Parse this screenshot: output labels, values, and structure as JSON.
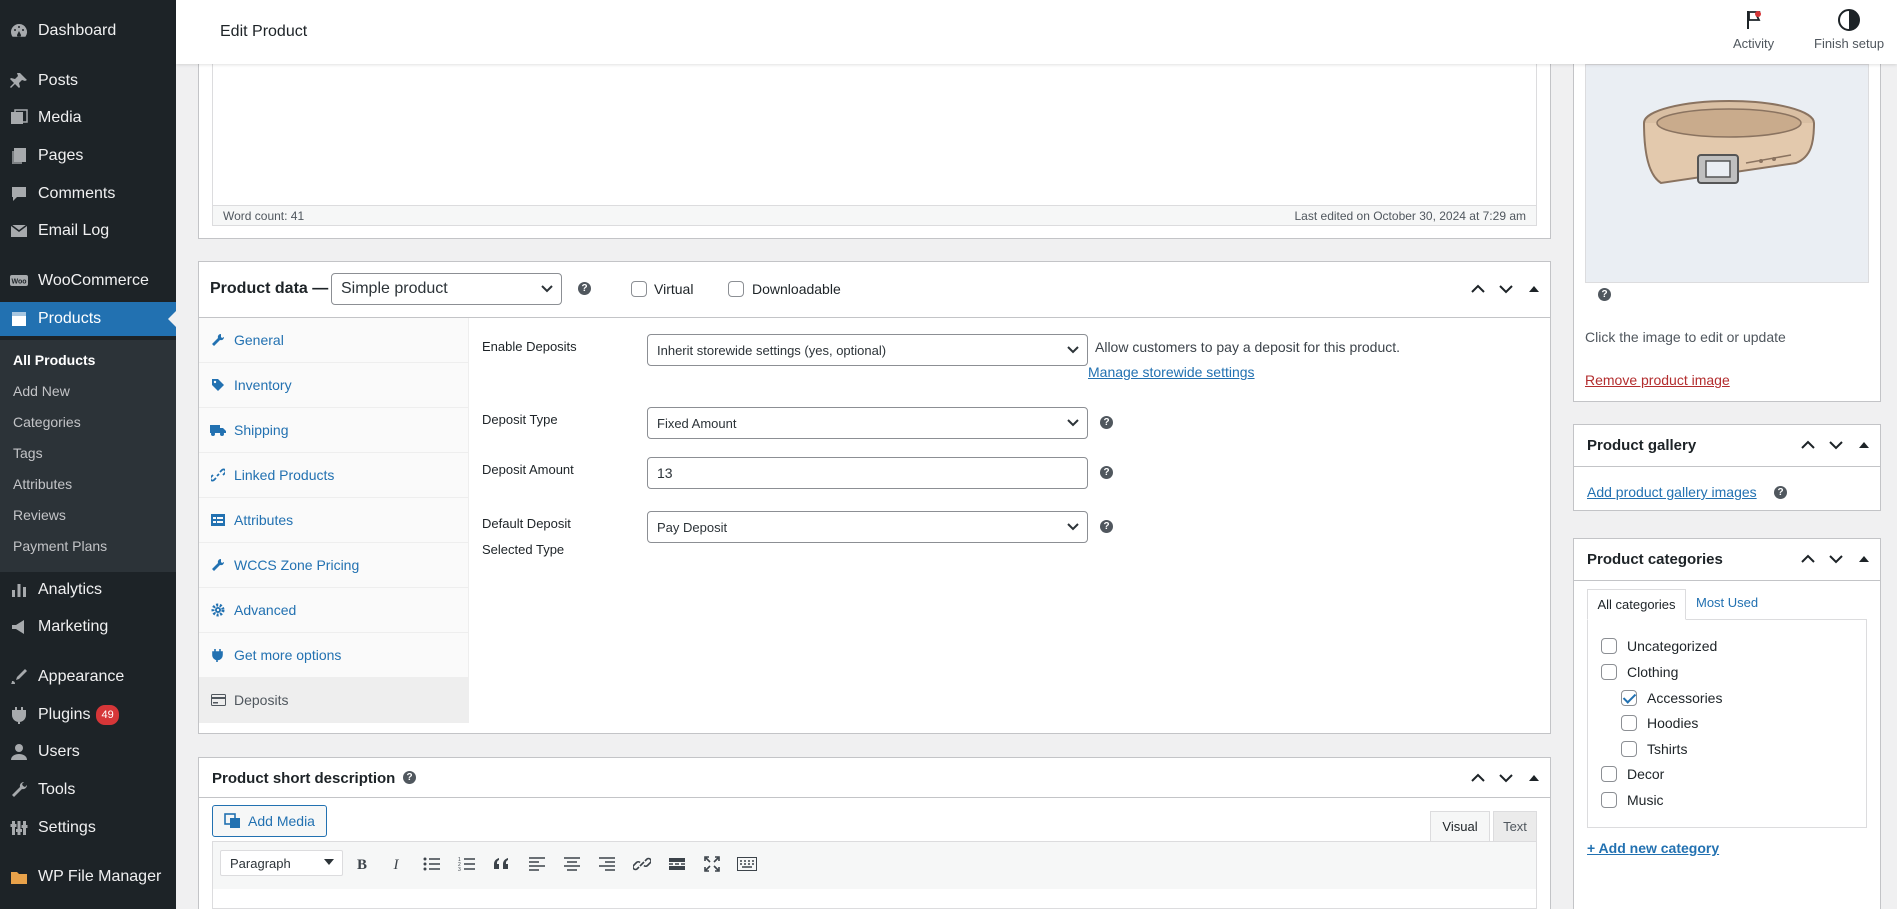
{
  "sidebar": {
    "items": [
      {
        "label": "Dashboard",
        "icon": "dashboard-icon"
      },
      {
        "label": "Posts",
        "icon": "pin-icon"
      },
      {
        "label": "Media",
        "icon": "media-icon"
      },
      {
        "label": "Pages",
        "icon": "pages-icon"
      },
      {
        "label": "Comments",
        "icon": "comments-icon"
      },
      {
        "label": "Email Log",
        "icon": "email-icon"
      },
      {
        "label": "WooCommerce",
        "icon": "woocommerce-icon"
      },
      {
        "label": "Products",
        "icon": "products-icon"
      },
      {
        "label": "Analytics",
        "icon": "analytics-icon"
      },
      {
        "label": "Marketing",
        "icon": "marketing-icon"
      },
      {
        "label": "Appearance",
        "icon": "appearance-icon"
      },
      {
        "label": "Plugins",
        "icon": "plugins-icon",
        "badge": "49"
      },
      {
        "label": "Users",
        "icon": "users-icon"
      },
      {
        "label": "Tools",
        "icon": "tools-icon"
      },
      {
        "label": "Settings",
        "icon": "settings-icon"
      },
      {
        "label": "WP File Manager",
        "icon": "file-manager-icon"
      }
    ],
    "submenu": [
      "All Products",
      "Add New",
      "Categories",
      "Tags",
      "Attributes",
      "Reviews",
      "Payment Plans"
    ]
  },
  "header": {
    "title": "Edit Product",
    "activity": "Activity",
    "finish_setup": "Finish setup"
  },
  "editor": {
    "word_count": "Word count: 41",
    "last_edited": "Last edited on October 30, 2024 at 7:29 am"
  },
  "product_data": {
    "title": "Product data —",
    "type": "Simple product",
    "virtual": "Virtual",
    "downloadable": "Downloadable",
    "tabs": [
      "General",
      "Inventory",
      "Shipping",
      "Linked Products",
      "Attributes",
      "WCCS Zone Pricing",
      "Advanced",
      "Get more options",
      "Deposits"
    ],
    "fields": {
      "enable_deposits_label": "Enable Deposits",
      "enable_deposits_value": "Inherit storewide settings (yes, optional)",
      "enable_deposits_desc": "Allow customers to pay a deposit for this product.",
      "manage_link": "Manage storewide settings",
      "deposit_type_label": "Deposit Type",
      "deposit_type_value": "Fixed Amount",
      "deposit_amount_label": "Deposit Amount",
      "deposit_amount_value": "13",
      "default_type_label_1": "Default Deposit",
      "default_type_label_2": "Selected Type",
      "default_type_value": "Pay Deposit"
    }
  },
  "short_description": {
    "title": "Product short description",
    "add_media": "Add Media",
    "tab_visual": "Visual",
    "tab_text": "Text",
    "format": "Paragraph"
  },
  "product_image": {
    "hint": "Click the image to edit or update",
    "remove": "Remove product image"
  },
  "gallery": {
    "title": "Product gallery",
    "add_link": "Add product gallery images"
  },
  "categories": {
    "title": "Product categories",
    "tab_all": "All categories",
    "tab_most": "Most Used",
    "items": [
      {
        "label": "Uncategorized",
        "checked": false
      },
      {
        "label": "Clothing",
        "checked": false
      },
      {
        "label": "Accessories",
        "checked": true
      },
      {
        "label": "Hoodies",
        "checked": false
      },
      {
        "label": "Tshirts",
        "checked": false
      },
      {
        "label": "Decor",
        "checked": false
      },
      {
        "label": "Music",
        "checked": false
      }
    ],
    "add_new": "+ Add new category"
  },
  "colors": {
    "sidebar_bg": "#1d2327",
    "accent": "#2271b1",
    "badge": "#d63638",
    "remove_link": "#b32d2e"
  }
}
